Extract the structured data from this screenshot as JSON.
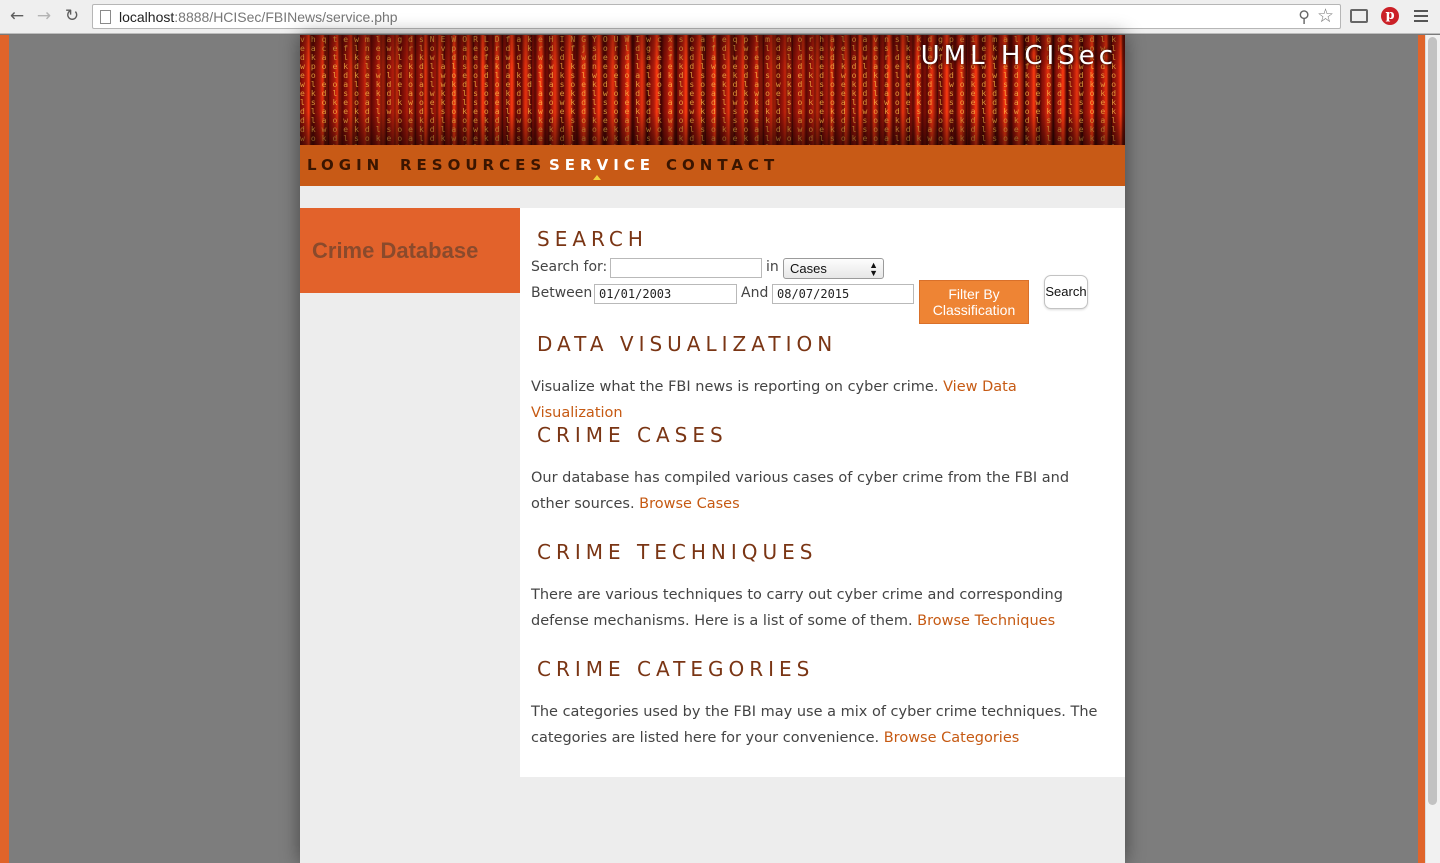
{
  "browser": {
    "url_host": "localhost",
    "url_rest": ":8888/HCISec/FBINews/service.php"
  },
  "site": {
    "title": "UML HCISec"
  },
  "nav": {
    "items": [
      {
        "label": "LOGIN",
        "active": false
      },
      {
        "label": "RESOURCES",
        "active": false
      },
      {
        "label": "SERVICE",
        "active": true
      },
      {
        "label": "CONTACT",
        "active": false
      }
    ]
  },
  "sidebar": {
    "heading": "Crime Database"
  },
  "search": {
    "title": "SEARCH",
    "search_for_label": "Search for:",
    "search_for_value": "",
    "in_label": "in",
    "in_select_value": "Cases",
    "between_label": "Between",
    "start_date": "01/01/2003",
    "and_label": "And",
    "end_date": "08/07/2015",
    "filter_button": "Filter By Classification",
    "search_button": "Search"
  },
  "sections": [
    {
      "title": "DATA VISUALIZATION",
      "text": "Visualize what the FBI news is reporting on cyber crime. ",
      "link": "View Data Visualization"
    },
    {
      "title": "CRIME CASES",
      "text": "Our database has compiled various cases of cyber crime from the FBI and other sources. ",
      "link": "Browse Cases"
    },
    {
      "title": "CRIME TECHNIQUES",
      "text": "There are various techniques to carry out cyber crime and corresponding defense mechanisms. Here is a list of some of them. ",
      "link": "Browse Techniques"
    },
    {
      "title": "CRIME CATEGORIES",
      "text": "The categories used by the FBI may use a mix of cyber crime techniques. The categories are listed here for your convenience. ",
      "link": "Browse Categories"
    }
  ],
  "colors": {
    "accent": "#e2622b",
    "nav_bg": "#c85a16",
    "heading": "#7a3514",
    "link": "#c65a13",
    "filter_button": "#ee8434"
  },
  "icons": [
    "back-arrow-icon",
    "forward-arrow-icon",
    "reload-icon",
    "page-icon",
    "zoom-icon",
    "star-icon",
    "cast-icon",
    "pinterest-icon",
    "menu-icon"
  ]
}
